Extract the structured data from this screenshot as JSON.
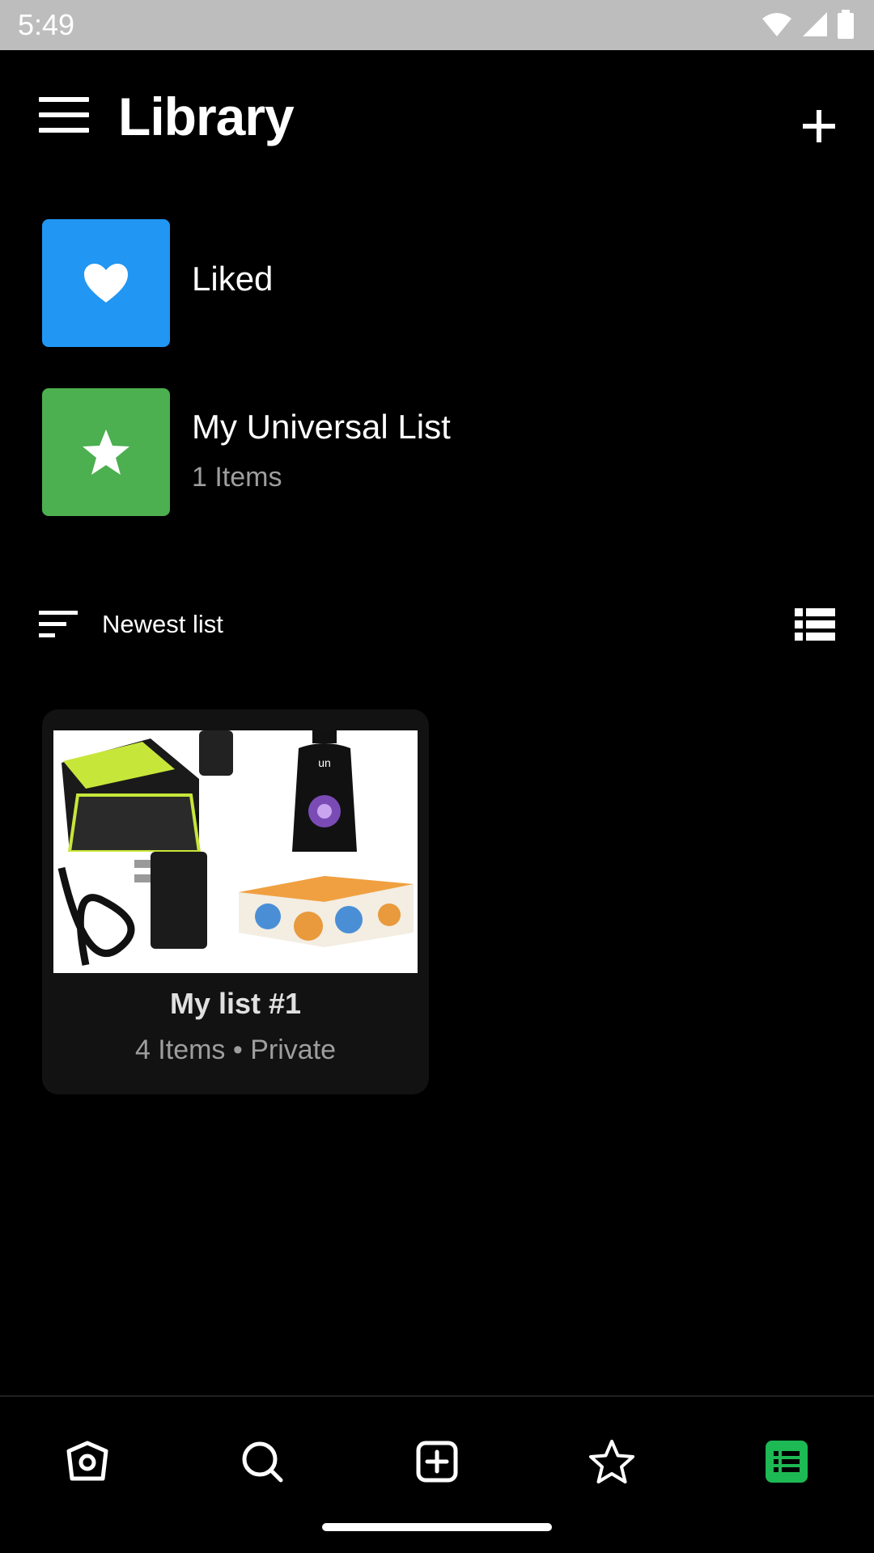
{
  "status_bar": {
    "time": "5:49",
    "icons": [
      "wifi-icon",
      "signal-icon",
      "battery-icon"
    ]
  },
  "app_bar": {
    "title": "Library",
    "menu_icon": "hamburger-icon",
    "add_icon": "plus-icon"
  },
  "pinned": [
    {
      "title": "Liked",
      "subtitle": "",
      "icon": "heart-icon",
      "color": "#2196F3"
    },
    {
      "title": "My Universal List",
      "subtitle": "1 Items",
      "icon": "star-icon",
      "color": "#4CAF50"
    }
  ],
  "sort": {
    "label": "Newest list",
    "icon": "sort-icon",
    "view_icon": "list-view-icon"
  },
  "lists": [
    {
      "title": "My list #1",
      "meta": "4 Items • Private",
      "images": [
        "trimmer-case-image",
        "detergent-bottle-image",
        "charger-image",
        "tissue-box-image"
      ]
    }
  ],
  "bottom_nav": [
    {
      "name": "home",
      "icon": "home-icon",
      "active": false
    },
    {
      "name": "search",
      "icon": "search-icon",
      "active": false
    },
    {
      "name": "add",
      "icon": "add-box-icon",
      "active": false
    },
    {
      "name": "favorites",
      "icon": "star-outline-icon",
      "active": false
    },
    {
      "name": "library",
      "icon": "list-icon",
      "active": true
    }
  ],
  "colors": {
    "background": "#000000",
    "active": "#1DB954",
    "liked": "#2196F3",
    "universal": "#4CAF50"
  }
}
